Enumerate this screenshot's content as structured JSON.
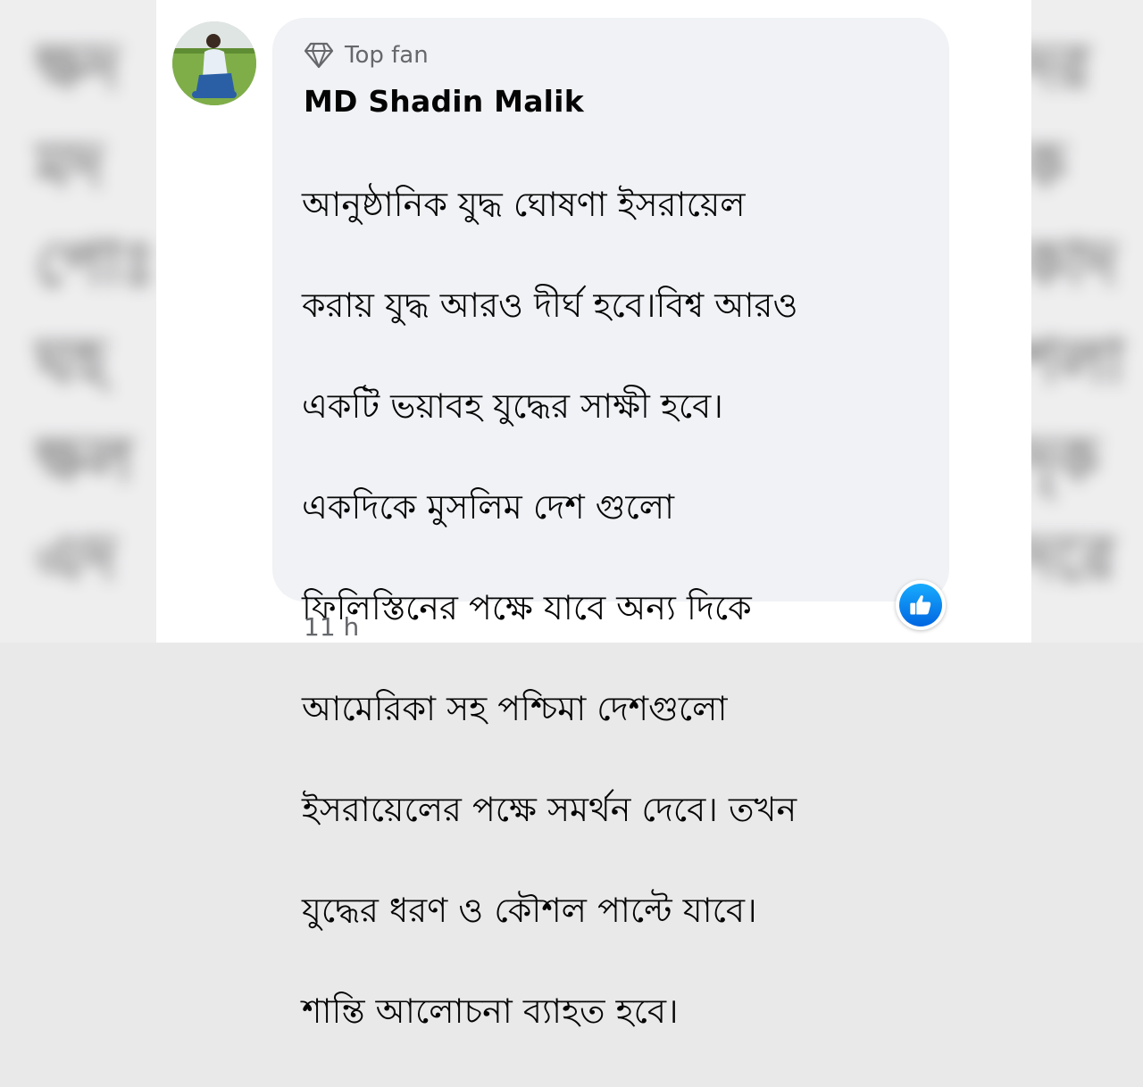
{
  "comment": {
    "badge_icon": "diamond-icon",
    "badge_label": "Top fan",
    "author": "MD Shadin Malik",
    "lines": [
      "আনুষ্ঠানিক যুদ্ধ ঘোষণা ইসরায়েল",
      "করায় যুদ্ধ আরও দীর্ঘ হবে।বিশ্ব আরও",
      "একটি ভয়াবহ যুদ্ধের সাক্ষী হবে।",
      "একদিকে মুসলিম দেশ গুলো",
      "ফিলিস্তিনের পক্ষে যাবে অন্য দিকে",
      "আমেরিকা সহ পশ্চিমা দেশগুলো",
      "ইসরায়েলের পক্ষে সমর্থন দেবে। তখন",
      "যুদ্ধের ধরণ ও কৌশল পাল্টে যাবে।",
      "শান্তি আলোচনা ব্যাহত হবে।"
    ],
    "reaction_icon": "like-icon",
    "timestamp": "11 h"
  },
  "colors": {
    "bubble_bg": "#f0f2f5",
    "secondary_text": "#65676b",
    "like_blue": "#0866ff"
  }
}
